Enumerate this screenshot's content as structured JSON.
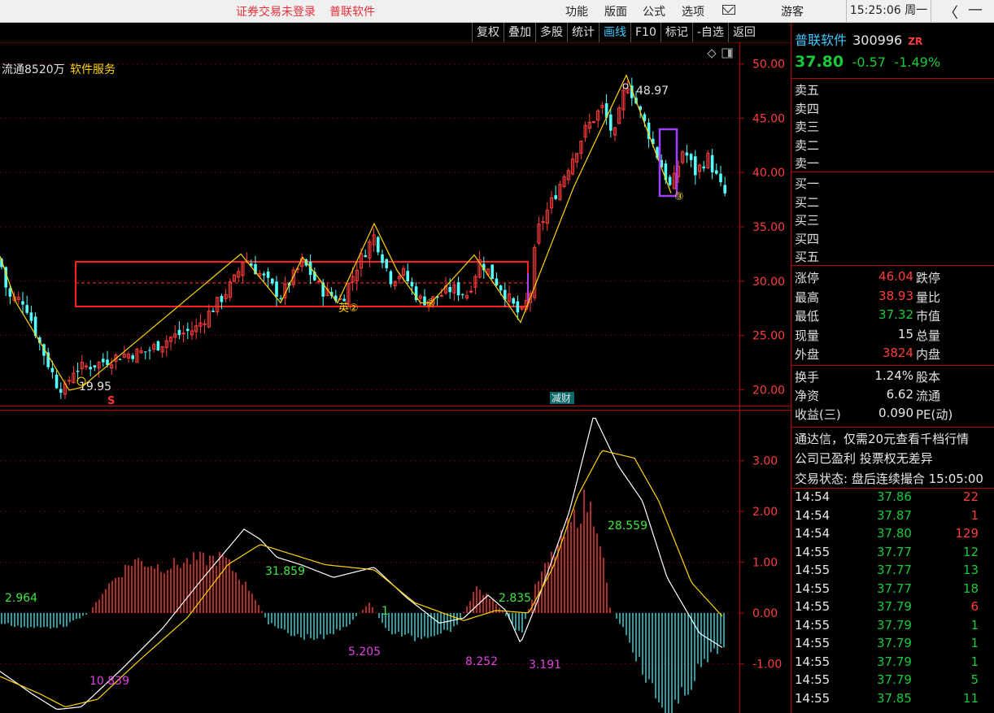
{
  "titlebar": {
    "login_status": "证券交易未登录",
    "app_name": "普联软件",
    "menus": [
      "功能",
      "版面",
      "公式",
      "选项"
    ],
    "user": "游客",
    "clock": "15:25:06 周一",
    "back_glyph": "〈",
    "min_glyph": "—"
  },
  "toolbar": {
    "buttons": [
      "复权",
      "叠加",
      "多股",
      "统计",
      "画线",
      "F10",
      "标记",
      "-自选",
      "返回"
    ],
    "active": "画线"
  },
  "chart_info": {
    "float_shares": "流通8520万",
    "industry": "软件服务"
  },
  "chart_data": {
    "type": "candlestick",
    "price_axis": {
      "ticks": [
        "50.00",
        "45.00",
        "40.00",
        "35.00",
        "30.00",
        "25.00",
        "20.00"
      ],
      "range": [
        18.9,
        51.7
      ]
    },
    "macd_axis": {
      "ticks": [
        "3.00",
        "2.00",
        "1.00",
        "0.00",
        "-1.00"
      ],
      "range": [
        -1.97,
        3.97
      ]
    },
    "annotations": {
      "high_label": "48.97",
      "low_label": "19.95",
      "pattern_label_a": "英②",
      "pattern_label_b": "②",
      "pattern_label_c": "③",
      "low_marker": "S",
      "event_marker": "减财"
    },
    "macd_labels": [
      "2.964",
      "10.839",
      "31.859",
      "5.205",
      "1",
      "8.252",
      "2.835",
      "3.191",
      "28.559"
    ],
    "close_anchors": [
      [
        0,
        32.0
      ],
      [
        10,
        28.5
      ],
      [
        30,
        28.2
      ],
      [
        50,
        24.0
      ],
      [
        70,
        20.5
      ],
      [
        80,
        20.0
      ],
      [
        90,
        21.8
      ],
      [
        120,
        22.4
      ],
      [
        150,
        23.2
      ],
      [
        180,
        23.5
      ],
      [
        210,
        24.8
      ],
      [
        240,
        25.6
      ],
      [
        270,
        28.2
      ],
      [
        290,
        30.3
      ],
      [
        300,
        32.2
      ],
      [
        320,
        30.6
      ],
      [
        345,
        28.6
      ],
      [
        372,
        31.8
      ],
      [
        395,
        29.2
      ],
      [
        420,
        28.2
      ],
      [
        440,
        31.6
      ],
      [
        460,
        34.2
      ],
      [
        480,
        30.2
      ],
      [
        495,
        30.8
      ],
      [
        515,
        28.3
      ],
      [
        530,
        28.2
      ],
      [
        555,
        29.3
      ],
      [
        575,
        28.8
      ],
      [
        590,
        31.9
      ],
      [
        615,
        29.5
      ],
      [
        640,
        26.7
      ],
      [
        652,
        29.0
      ],
      [
        660,
        34.5
      ],
      [
        675,
        36.8
      ],
      [
        700,
        40.8
      ],
      [
        720,
        44.0
      ],
      [
        740,
        46.0
      ],
      [
        755,
        43.2
      ],
      [
        770,
        48.5
      ],
      [
        790,
        45.0
      ],
      [
        810,
        41.2
      ],
      [
        825,
        38.4
      ],
      [
        840,
        42.2
      ],
      [
        855,
        40.0
      ],
      [
        870,
        41.4
      ],
      [
        890,
        38.0
      ]
    ],
    "zigzag": [
      [
        0,
        32.3
      ],
      [
        20,
        28.0
      ],
      [
        85,
        19.95
      ],
      [
        100,
        20.2
      ],
      [
        296,
        32.5
      ],
      [
        345,
        28.0
      ],
      [
        372,
        32.2
      ],
      [
        415,
        28.0
      ],
      [
        460,
        35.3
      ],
      [
        488,
        31.0
      ],
      [
        517,
        28.0
      ],
      [
        530,
        28.0
      ],
      [
        583,
        32.4
      ],
      [
        640,
        26.2
      ],
      [
        705,
        38.6
      ],
      [
        770,
        48.97
      ],
      [
        825,
        38.1
      ]
    ],
    "dif_anchors": [
      [
        0,
        -1.15
      ],
      [
        40,
        -1.6
      ],
      [
        70,
        -1.9
      ],
      [
        100,
        -1.85
      ],
      [
        150,
        -1.1
      ],
      [
        200,
        -0.3
      ],
      [
        245,
        0.6
      ],
      [
        300,
        1.65
      ],
      [
        320,
        1.45
      ],
      [
        340,
        1.1
      ],
      [
        370,
        0.95
      ],
      [
        410,
        0.7
      ],
      [
        460,
        0.9
      ],
      [
        500,
        0.3
      ],
      [
        540,
        -0.2
      ],
      [
        570,
        -0.1
      ],
      [
        600,
        0.35
      ],
      [
        622,
        0.05
      ],
      [
        640,
        -0.6
      ],
      [
        660,
        0.2
      ],
      [
        700,
        2.0
      ],
      [
        730,
        3.9
      ],
      [
        760,
        2.9
      ],
      [
        790,
        2.2
      ],
      [
        820,
        0.7
      ],
      [
        860,
        -0.4
      ],
      [
        890,
        -0.7
      ]
    ],
    "dea_anchors": [
      [
        0,
        -1.25
      ],
      [
        50,
        -1.6
      ],
      [
        80,
        -1.85
      ],
      [
        120,
        -1.7
      ],
      [
        170,
        -0.95
      ],
      [
        230,
        -0.1
      ],
      [
        280,
        0.95
      ],
      [
        320,
        1.35
      ],
      [
        360,
        1.15
      ],
      [
        400,
        0.95
      ],
      [
        460,
        0.85
      ],
      [
        510,
        0.2
      ],
      [
        570,
        -0.15
      ],
      [
        610,
        0.05
      ],
      [
        650,
        0.0
      ],
      [
        680,
        0.9
      ],
      [
        710,
        2.3
      ],
      [
        740,
        3.2
      ],
      [
        780,
        3.05
      ],
      [
        810,
        2.2
      ],
      [
        850,
        0.6
      ],
      [
        890,
        -0.1
      ]
    ],
    "hist_anchors": [
      [
        0,
        -0.2
      ],
      [
        40,
        -0.3
      ],
      [
        80,
        -0.25
      ],
      [
        110,
        0.0
      ],
      [
        130,
        0.5
      ],
      [
        165,
        1.05
      ],
      [
        200,
        0.9
      ],
      [
        240,
        1.05
      ],
      [
        275,
        1.08
      ],
      [
        310,
        0.4
      ],
      [
        330,
        -0.2
      ],
      [
        360,
        -0.45
      ],
      [
        400,
        -0.5
      ],
      [
        430,
        -0.2
      ],
      [
        455,
        0.2
      ],
      [
        475,
        -0.35
      ],
      [
        510,
        -0.5
      ],
      [
        560,
        -0.3
      ],
      [
        585,
        0.5
      ],
      [
        610,
        0.2
      ],
      [
        640,
        -0.45
      ],
      [
        660,
        0.6
      ],
      [
        700,
        1.7
      ],
      [
        720,
        2.2
      ],
      [
        735,
        1.8
      ],
      [
        750,
        0.1
      ],
      [
        770,
        -0.4
      ],
      [
        800,
        -1.5
      ],
      [
        825,
        -2.1
      ],
      [
        855,
        -1.2
      ],
      [
        890,
        -0.6
      ]
    ]
  },
  "quote": {
    "name": "普联软件",
    "code": "300996",
    "badge": "ZR",
    "price": "37.80",
    "change": "-0.57",
    "change_pct": "-1.49%",
    "sell_levels": [
      "卖五",
      "卖四",
      "卖三",
      "卖二",
      "卖一"
    ],
    "buy_levels": [
      "买一",
      "买二",
      "买三",
      "买四",
      "买五"
    ],
    "stats_left": [
      {
        "label": "涨停",
        "value": "46.04",
        "color": "up",
        "label2": "跌停"
      },
      {
        "label": "最高",
        "value": "38.93",
        "color": "up",
        "label2": "量比"
      },
      {
        "label": "最低",
        "value": "37.32",
        "color": "dn",
        "label2": "市值"
      },
      {
        "label": "现量",
        "value": "15",
        "color": "wht",
        "label2": "总量"
      },
      {
        "label": "外盘",
        "value": "3824",
        "color": "up",
        "label2": "内盘"
      }
    ],
    "stats_bottom": [
      {
        "label": "换手",
        "value": "1.24%",
        "label2": "股本"
      },
      {
        "label": "净资",
        "value": "6.62",
        "label2": "流通"
      },
      {
        "label": "收益(三)",
        "value": "0.090",
        "label2": "PE(动)"
      }
    ],
    "notice1": "通达信，仅需20元查看千档行情",
    "notice2": "公司已盈利 投票权无差异",
    "trade_status": "交易状态: 盘后连续撮合 15:05:00",
    "ticks": [
      {
        "time": "14:54",
        "price": "37.86",
        "vol": "22",
        "dir": "up"
      },
      {
        "time": "14:54",
        "price": "37.87",
        "vol": "1",
        "dir": "up"
      },
      {
        "time": "14:54",
        "price": "37.80",
        "vol": "129",
        "dir": "up"
      },
      {
        "time": "14:55",
        "price": "37.77",
        "vol": "12",
        "dir": "dn"
      },
      {
        "time": "14:55",
        "price": "37.77",
        "vol": "13",
        "dir": "dn"
      },
      {
        "time": "14:55",
        "price": "37.77",
        "vol": "18",
        "dir": "dn"
      },
      {
        "time": "14:55",
        "price": "37.79",
        "vol": "6",
        "dir": "up"
      },
      {
        "time": "14:55",
        "price": "37.79",
        "vol": "1",
        "dir": "dn"
      },
      {
        "time": "14:55",
        "price": "37.79",
        "vol": "1",
        "dir": "dn"
      },
      {
        "time": "14:55",
        "price": "37.79",
        "vol": "1",
        "dir": "dn"
      },
      {
        "time": "14:55",
        "price": "37.79",
        "vol": "5",
        "dir": "dn"
      },
      {
        "time": "14:55",
        "price": "37.85",
        "vol": "11",
        "dir": "dn"
      }
    ]
  }
}
